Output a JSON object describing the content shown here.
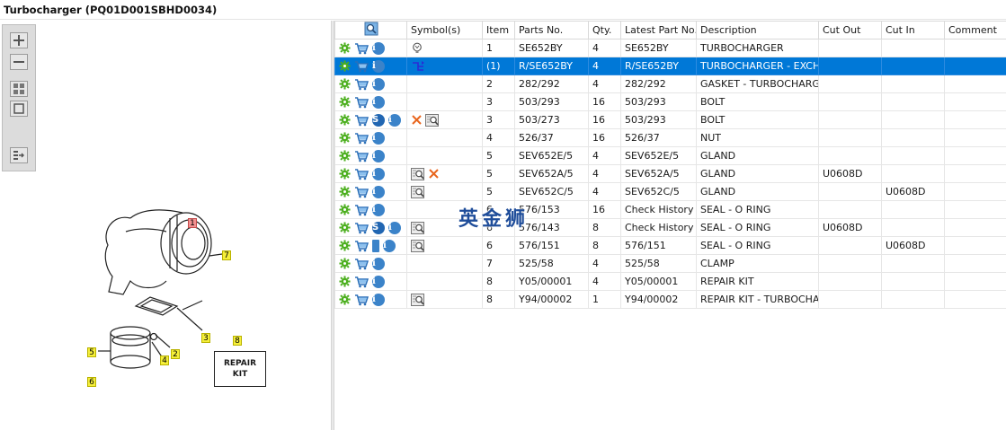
{
  "window": {
    "title": "Turbocharger (PQ01D001SBHD0034)"
  },
  "watermark": "英金狮",
  "toolbar": [
    {
      "name": "zoom-in-button",
      "icon": "zoom-in-icon"
    },
    {
      "name": "zoom-out-button",
      "icon": "zoom-out-icon"
    },
    {
      "name": "fit-all-button",
      "icon": "grid-icon"
    },
    {
      "name": "actual-size-button",
      "icon": "square-icon"
    },
    {
      "name": "export-button",
      "icon": "list-export-icon"
    }
  ],
  "diagram": {
    "callouts": [
      "1",
      "2",
      "3",
      "4",
      "5",
      "6",
      "7",
      "8"
    ],
    "repair_kit_label_line1": "REPAIR",
    "repair_kit_label_line2": "KIT"
  },
  "table": {
    "columns": [
      "",
      "Symbol(s)",
      "Item",
      "Parts No.",
      "Qty.",
      "Latest Part No.",
      "Description",
      "Cut Out",
      "Cut In",
      "Comment"
    ],
    "rows": [
      {
        "actions": [
          "gear",
          "cart",
          "info"
        ],
        "symbols": [
          "lamp"
        ],
        "item": "1",
        "part_no": "SE652BY",
        "qty": "4",
        "latest": "SE652BY",
        "desc": "TURBOCHARGER",
        "cut_out": "",
        "cut_in": "",
        "comment": ""
      },
      {
        "actions": [
          "gear",
          "cart",
          "info"
        ],
        "symbols": [
          "tree"
        ],
        "item": "(1)",
        "part_no": "R/SE652BY",
        "qty": "4",
        "latest": "R/SE652BY",
        "desc": "TURBOCHARGER - EXCHA",
        "cut_out": "",
        "cut_in": "",
        "comment": "",
        "selected": true
      },
      {
        "actions": [
          "gear",
          "cart",
          "info"
        ],
        "symbols": [],
        "item": "2",
        "part_no": "282/292",
        "qty": "4",
        "latest": "282/292",
        "desc": "GASKET - TURBOCHARGEF",
        "cut_out": "",
        "cut_in": "",
        "comment": ""
      },
      {
        "actions": [
          "gear",
          "cart",
          "info"
        ],
        "symbols": [],
        "item": "3",
        "part_no": "503/293",
        "qty": "16",
        "latest": "503/293",
        "desc": "BOLT",
        "cut_out": "",
        "cut_in": "",
        "comment": ""
      },
      {
        "actions": [
          "gear",
          "cart",
          "s",
          "info"
        ],
        "symbols": [
          "cross",
          "magnifier"
        ],
        "item": "3",
        "part_no": "503/273",
        "qty": "16",
        "latest": "503/293",
        "desc": "BOLT",
        "cut_out": "",
        "cut_in": "",
        "comment": ""
      },
      {
        "actions": [
          "gear",
          "cart",
          "info"
        ],
        "symbols": [],
        "item": "4",
        "part_no": "526/37",
        "qty": "16",
        "latest": "526/37",
        "desc": "NUT",
        "cut_out": "",
        "cut_in": "",
        "comment": ""
      },
      {
        "actions": [
          "gear",
          "cart",
          "info"
        ],
        "symbols": [],
        "item": "5",
        "part_no": "SEV652E/5",
        "qty": "4",
        "latest": "SEV652E/5",
        "desc": "GLAND",
        "cut_out": "",
        "cut_in": "",
        "comment": ""
      },
      {
        "actions": [
          "gear",
          "cart",
          "info"
        ],
        "symbols": [
          "magnifier",
          "cross"
        ],
        "item": "5",
        "part_no": "SEV652A/5",
        "qty": "4",
        "latest": "SEV652A/5",
        "desc": "GLAND",
        "cut_out": "U0608D",
        "cut_in": "",
        "comment": ""
      },
      {
        "actions": [
          "gear",
          "cart",
          "info"
        ],
        "symbols": [
          "magnifier"
        ],
        "item": "5",
        "part_no": "SEV652C/5",
        "qty": "4",
        "latest": "SEV652C/5",
        "desc": "GLAND",
        "cut_out": "",
        "cut_in": "U0608D",
        "comment": ""
      },
      {
        "actions": [
          "gear",
          "cart",
          "info"
        ],
        "symbols": [],
        "item": "6",
        "part_no": "576/153",
        "qty": "16",
        "latest": "Check History",
        "desc": "SEAL - O RING",
        "cut_out": "",
        "cut_in": "",
        "comment": ""
      },
      {
        "actions": [
          "gear",
          "cart",
          "s",
          "info"
        ],
        "symbols": [
          "magnifier"
        ],
        "item": "6",
        "part_no": "576/143",
        "qty": "8",
        "latest": "Check History",
        "desc": "SEAL - O RING",
        "cut_out": "U0608D",
        "cut_in": "",
        "comment": ""
      },
      {
        "actions": [
          "gear",
          "cart",
          "book",
          "info"
        ],
        "symbols": [
          "magnifier"
        ],
        "item": "6",
        "part_no": "576/151",
        "qty": "8",
        "latest": "576/151",
        "desc": "SEAL - O RING",
        "cut_out": "",
        "cut_in": "U0608D",
        "comment": ""
      },
      {
        "actions": [
          "gear",
          "cart",
          "info"
        ],
        "symbols": [],
        "item": "7",
        "part_no": "525/58",
        "qty": "4",
        "latest": "525/58",
        "desc": "CLAMP",
        "cut_out": "",
        "cut_in": "",
        "comment": ""
      },
      {
        "actions": [
          "gear",
          "cart",
          "info"
        ],
        "symbols": [],
        "item": "8",
        "part_no": "Y05/00001",
        "qty": "4",
        "latest": "Y05/00001",
        "desc": "REPAIR KIT",
        "cut_out": "",
        "cut_in": "",
        "comment": ""
      },
      {
        "actions": [
          "gear",
          "cart",
          "info"
        ],
        "symbols": [
          "magnifier"
        ],
        "item": "8",
        "part_no": "Y94/00002",
        "qty": "1",
        "latest": "Y94/00002",
        "desc": "REPAIR KIT - TURBOCHAR(",
        "cut_out": "",
        "cut_in": "",
        "comment": ""
      }
    ]
  },
  "colors": {
    "selection": "#0078d7",
    "gear": "#4caf1e",
    "cart": "#2b6fb8",
    "info": "#3b83c9",
    "cross": "#e8661e"
  }
}
